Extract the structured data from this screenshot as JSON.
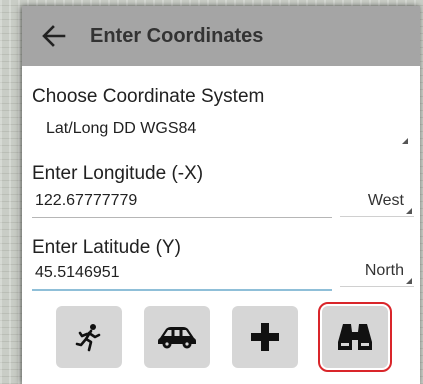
{
  "header": {
    "title": "Enter Coordinates",
    "back_icon": "arrow-left-icon"
  },
  "coordinate_system": {
    "label": "Choose Coordinate System",
    "selected": "Lat/Long DD WGS84"
  },
  "longitude": {
    "label": "Enter Longitude (-X)",
    "value": "122.67777779",
    "direction": "West"
  },
  "latitude": {
    "label": "Enter Latitude (Y)",
    "value": "45.5146951",
    "direction": "North"
  },
  "buttons": [
    {
      "icon": "running-person-icon"
    },
    {
      "icon": "car-icon"
    },
    {
      "icon": "plus-icon"
    },
    {
      "icon": "binoculars-icon",
      "highlighted": true
    }
  ],
  "colors": {
    "header_bg": "#a5a5a5",
    "button_bg": "#d6d6d6",
    "highlight": "#d9252a",
    "active_underline": "#8fbfd8"
  }
}
